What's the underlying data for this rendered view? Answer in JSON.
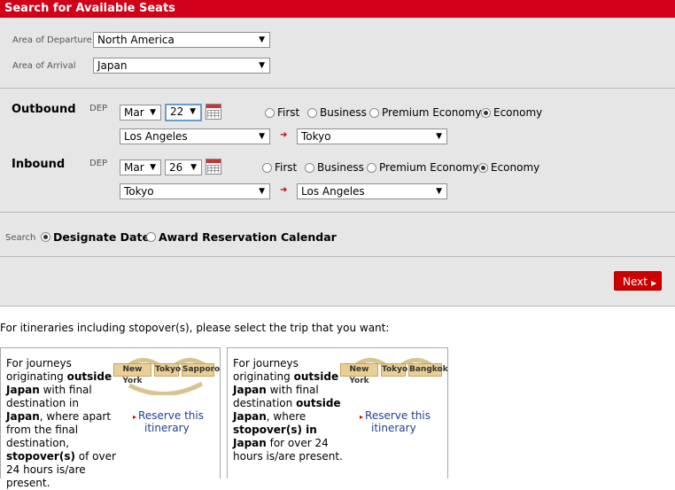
{
  "page_title": "Search for Available Seats",
  "area": {
    "departure_label": "Area of Departure",
    "departure_value": "North America",
    "arrival_label": "Area of Arrival",
    "arrival_value": "Japan"
  },
  "outbound": {
    "heading": "Outbound",
    "dep_label": "DEP",
    "month": "Mar",
    "day": "22",
    "classes": [
      "First",
      "Business",
      "Premium Economy",
      "Economy"
    ],
    "selected_class": "Economy",
    "from": "Los Angeles",
    "to": "Tokyo"
  },
  "inbound": {
    "heading": "Inbound",
    "dep_label": "DEP",
    "month": "Mar",
    "day": "26",
    "classes": [
      "First",
      "Business",
      "Premium Economy",
      "Economy"
    ],
    "selected_class": "Economy",
    "from": "Tokyo",
    "to": "Los Angeles"
  },
  "search": {
    "label": "Search",
    "options": [
      "Designate Date",
      "Award Reservation Calendar"
    ],
    "selected": "Designate Date"
  },
  "next_label": "Next",
  "stopover_intro": "For itineraries including stopover(s), please select the trip that you want:",
  "cards": [
    {
      "text_parts": [
        "For journeys originating ",
        "outside Japan",
        " with final destination in ",
        "Japan",
        ", where apart from the final destination, ",
        "stopover(s)",
        " of over 24 hours is/are present."
      ],
      "cities": [
        "New York",
        "Tokyo",
        "Sapporo"
      ],
      "reserve_line1": "Reserve this",
      "reserve_line2": "itinerary"
    },
    {
      "text_parts": [
        "For journeys originating ",
        "outside Japan",
        " with final destination ",
        "outside Japan",
        ", where ",
        "stopover(s) in Japan",
        " for over 24 hours is/are present."
      ],
      "cities": [
        "New York",
        "Tokyo",
        "Bangkok"
      ],
      "reserve_line1": "Reserve this",
      "reserve_line2": "itinerary"
    }
  ],
  "colors": {
    "brand_red": "#d10019",
    "panel_gray": "#e6e6e6",
    "link_blue": "#203f8c",
    "tag_tan": "#e9cf95"
  },
  "icons": {
    "calendar": "calendar-icon",
    "flight_arrow": "arrow-right-icon",
    "dropdown": "chevron-down-icon"
  }
}
